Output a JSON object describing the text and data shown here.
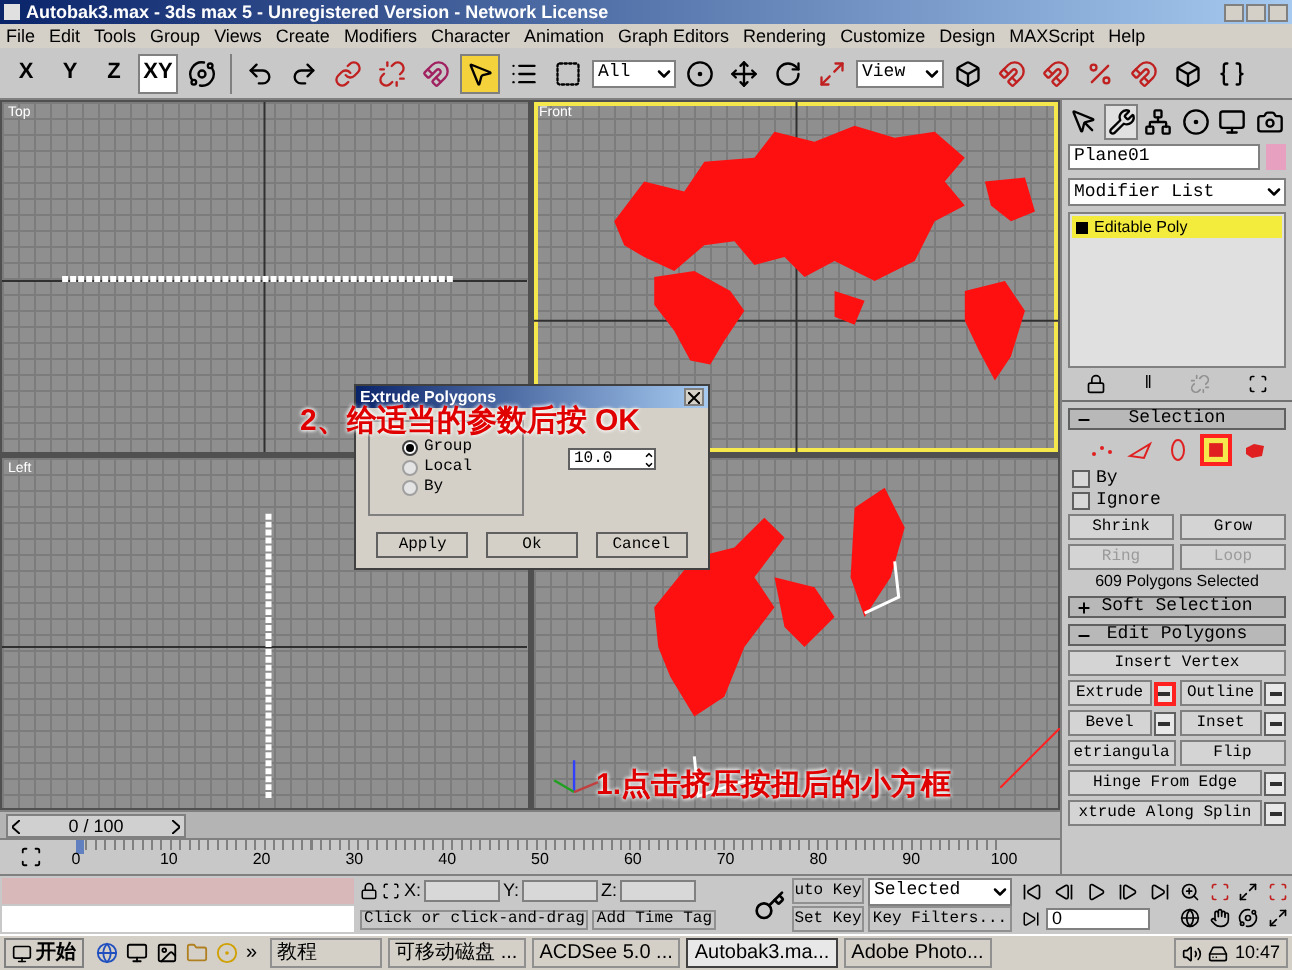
{
  "window": {
    "title": "Autobak3.max - 3ds max 5 - Unregistered Version - Network License"
  },
  "menu": [
    "File",
    "Edit",
    "Tools",
    "Group",
    "Views",
    "Create",
    "Modifiers",
    "Character",
    "Animation",
    "Graph Editors",
    "Rendering",
    "Customize",
    "Design",
    "MAXScript",
    "Help"
  ],
  "toolbar": {
    "axis_buttons": [
      {
        "label": "X",
        "selected": false
      },
      {
        "label": "Y",
        "selected": false
      },
      {
        "label": "Z",
        "selected": false
      },
      {
        "label": "XY",
        "selected": true
      }
    ],
    "select_object_active": true,
    "selection_filter": "All",
    "reference_coordinate": "View"
  },
  "viewports": [
    {
      "label": "Top",
      "kind": "top",
      "active": false
    },
    {
      "label": "Front",
      "kind": "front",
      "active": true
    },
    {
      "label": "Left",
      "kind": "left",
      "active": false
    },
    {
      "kind": "perspective",
      "active": false
    }
  ],
  "dialog": {
    "title": "Extrude Polygons",
    "options": [
      {
        "label": "Group",
        "selected": true
      },
      {
        "label": "Local",
        "selected": false
      },
      {
        "label": "By",
        "selected": false
      }
    ],
    "height_value": "10.0",
    "buttons": [
      "Apply",
      "Ok",
      "Cancel"
    ]
  },
  "annotations": [
    {
      "text": "2、给适当的参数后按 OK"
    },
    {
      "text": "1.点击挤压按扭后的小方框"
    }
  ],
  "command_panel": {
    "tabs": [
      {
        "kind": "create",
        "selected": false
      },
      {
        "kind": "modify",
        "selected": true
      },
      {
        "kind": "hierarchy",
        "selected": false
      },
      {
        "kind": "motion",
        "selected": false
      },
      {
        "kind": "display",
        "selected": false
      },
      {
        "kind": "utilities",
        "selected": false
      }
    ],
    "object_name": "Plane01",
    "modifier_list": "Modifier List",
    "stack": [
      {
        "label": "Editable Poly",
        "selected": true
      }
    ],
    "rollouts": [
      {
        "title": "Selection",
        "expanded": true,
        "kind": "selection",
        "subobjects": [
          {
            "kind": "vertex",
            "selected": false,
            "highlighted": false
          },
          {
            "kind": "edge",
            "selected": false,
            "highlighted": false
          },
          {
            "kind": "border",
            "selected": false,
            "highlighted": false
          },
          {
            "kind": "polygon",
            "selected": true,
            "highlighted": true
          },
          {
            "kind": "element",
            "selected": false,
            "highlighted": false
          }
        ],
        "checkboxes": [
          {
            "label": "By",
            "checked": false
          },
          {
            "label": "Ignore",
            "checked": false
          }
        ],
        "button_rows": [
          [
            {
              "label": "Shrink",
              "disabled": false
            },
            {
              "label": "Grow",
              "disabled": false
            }
          ],
          [
            {
              "label": "Ring",
              "disabled": true
            },
            {
              "label": "Loop",
              "disabled": true
            }
          ]
        ],
        "info": "609 Polygons Selected"
      },
      {
        "title": "Soft Selection",
        "expanded": false,
        "kind": "plain"
      },
      {
        "title": "Edit Polygons",
        "expanded": true,
        "kind": "buttons",
        "button_rows": [
          [
            {
              "label": "Insert Vertex",
              "settings": false
            }
          ],
          [
            {
              "label": "Extrude",
              "settings": true,
              "highlighted": true
            },
            {
              "label": "Outline",
              "settings": true,
              "highlighted": false
            }
          ],
          [
            {
              "label": "Bevel",
              "settings": true,
              "highlighted": false
            },
            {
              "label": "Inset",
              "settings": true,
              "highlighted": false
            }
          ],
          [
            {
              "label": "etriangula",
              "settings": false
            },
            {
              "label": "Flip",
              "settings": false
            }
          ],
          [
            {
              "label": "Hinge From Edge",
              "settings": true,
              "highlighted": false
            }
          ],
          [
            {
              "label": "xtrude Along Splin",
              "settings": true,
              "highlighted": false
            }
          ]
        ]
      }
    ]
  },
  "time_slider": {
    "reading": "0 / 100",
    "level": 0
  },
  "modifier_tools": {
    "separator": "‖"
  },
  "track_bar": {
    "ticks": [
      "0",
      "10",
      "20",
      "30",
      "40",
      "50",
      "60",
      "70",
      "80",
      "90",
      "100"
    ]
  },
  "status": {
    "coord_labels": [
      "X:",
      "Y:",
      "Z:"
    ],
    "prompt": "Click or click-and-drag",
    "add_time_tag": "Add Time Tag",
    "auto_key": "uto Key",
    "set_key": "Set Key",
    "key_mode": "Selected",
    "key_filters": "Key Filters...",
    "frame": "0"
  },
  "taskbar": {
    "start": "开始",
    "overflow": "»",
    "tasks": [
      {
        "label": "教程",
        "selected": false
      },
      {
        "label": "可移动磁盘 ...",
        "selected": false
      },
      {
        "label": "ACDSee 5.0 ...",
        "selected": false
      },
      {
        "label": "Autobak3.ma...",
        "selected": true
      },
      {
        "label": "Adobe Photo...",
        "selected": false
      }
    ],
    "clock": "10:47"
  }
}
